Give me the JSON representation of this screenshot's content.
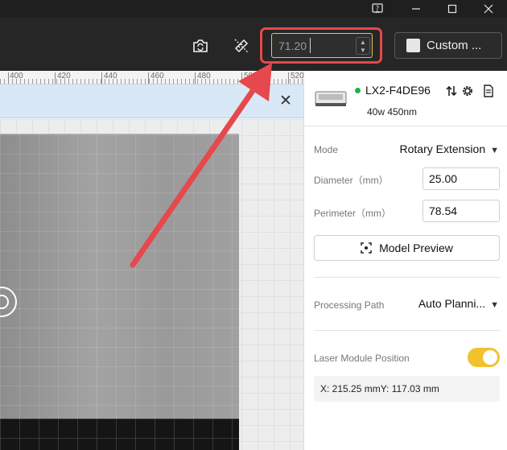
{
  "window": {
    "help_icon": "help-icon",
    "minimize_icon": "minimize-icon",
    "maximize_icon": "maximize-icon",
    "close_icon": "close-icon"
  },
  "toolbar": {
    "camera_icon": "camera-refresh-icon",
    "measure_icon": "measure-icon",
    "number_value": "71.20",
    "custom_label": "Custom ..."
  },
  "ruler": {
    "labels": [
      "400",
      "420",
      "440",
      "460",
      "480",
      "500",
      "520"
    ]
  },
  "banner": {
    "close_label": "✕"
  },
  "device": {
    "name": "LX2-F4DE96",
    "subtitle": "40w 450nm",
    "status_color": "#22b04a"
  },
  "settings": {
    "mode_label": "Mode",
    "mode_value": "Rotary Extension",
    "diameter_label": "Diameter（mm）",
    "diameter_value": "25.00",
    "perimeter_label": "Perimeter（mm）",
    "perimeter_value": "78.54",
    "preview_label": "Model Preview",
    "path_label": "Processing Path",
    "path_value": "Auto Planni...",
    "laser_label": "Laser Module Position",
    "laser_enabled": true,
    "x_label": "X: 215.25 mm",
    "y_label": "Y: 117.03 mm"
  },
  "colors": {
    "accent_yellow": "#f2c12e",
    "highlight_red": "#e5484d",
    "toolbar_bg": "#262626"
  }
}
